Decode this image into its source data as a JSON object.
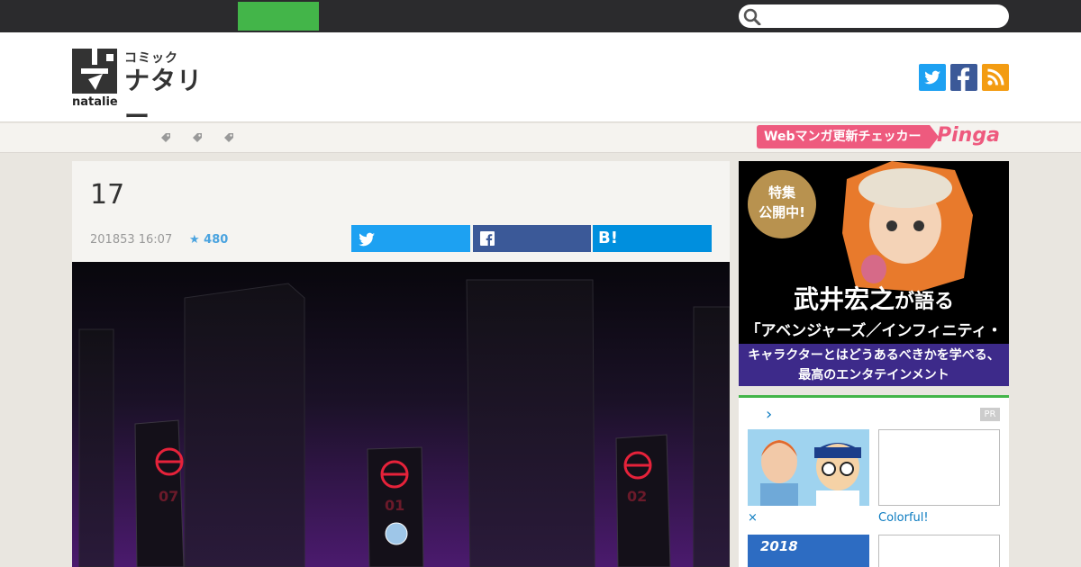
{
  "topbar": {
    "search_placeholder": ""
  },
  "header": {
    "logo_sub": "コミック",
    "logo_main": "ナタリー",
    "logo_brand": "natalie"
  },
  "subnav": {
    "pinga_label": "Webマンガ更新チェッカー",
    "pinga_logo": "Pinga"
  },
  "article": {
    "title": "17",
    "date": "201853 16:07",
    "star_count": "★ 480",
    "share_hatena": "B!",
    "monument_labels": [
      "07",
      "01",
      "02"
    ]
  },
  "sidebar_ad": {
    "badge_line1": "特集",
    "badge_line2": "公開中!",
    "headline_name": "武井宏之",
    "headline_suffix": "が語る",
    "subtitle": "「アベンジャーズ／インフィニティ・ウォー」",
    "tagline_line1": "キャラクターとはどうあるべきかを学べる、",
    "tagline_line2": "最高のエンタテインメント"
  },
  "pr": {
    "label": "PR",
    "caption1": "×",
    "caption2": "Colorful!",
    "thumb2_text": "2018"
  },
  "colors": {
    "topbar": "#2b2b2d",
    "accent_green": "#43b549",
    "twitter": "#1da1f2",
    "facebook": "#3b5998",
    "hatena": "#008fde",
    "rss": "#f39c12",
    "pinga": "#ee5a7e"
  }
}
